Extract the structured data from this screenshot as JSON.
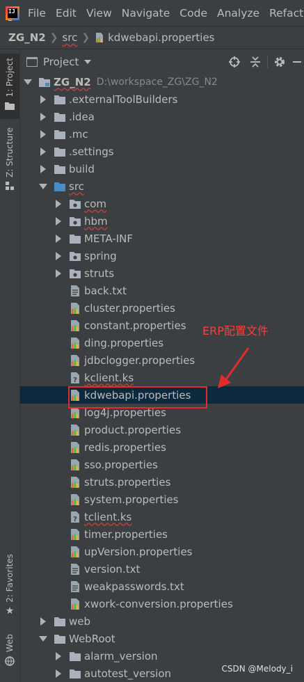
{
  "menu": [
    "File",
    "Edit",
    "View",
    "Navigate",
    "Code",
    "Analyze",
    "Refactor"
  ],
  "breadcrumb": [
    "ZG_N2",
    "src",
    "kdwebapi.properties"
  ],
  "left_tabs": [
    "1: Project",
    "Z: Structure",
    "2: Favorites",
    "Web"
  ],
  "panel": {
    "title": "Project"
  },
  "tree": [
    {
      "label": "ZG_N2",
      "depth": 0,
      "type": "module",
      "arrow": "down",
      "bold": true,
      "path": "D:\\workspace_ZG\\ZG_N2"
    },
    {
      "label": ".externalToolBuilders",
      "depth": 1,
      "type": "folder",
      "arrow": "right"
    },
    {
      "label": ".idea",
      "depth": 1,
      "type": "folder",
      "arrow": "right"
    },
    {
      "label": ".mc",
      "depth": 1,
      "type": "folder",
      "arrow": "right"
    },
    {
      "label": ".settings",
      "depth": 1,
      "type": "folder",
      "arrow": "right"
    },
    {
      "label": "build",
      "depth": 1,
      "type": "folder",
      "arrow": "right"
    },
    {
      "label": "src",
      "depth": 1,
      "type": "src-folder",
      "arrow": "down"
    },
    {
      "label": "com",
      "depth": 2,
      "type": "package",
      "arrow": "right"
    },
    {
      "label": "hbm",
      "depth": 2,
      "type": "package",
      "arrow": "right"
    },
    {
      "label": "META-INF",
      "depth": 2,
      "type": "folder",
      "arrow": "right"
    },
    {
      "label": "spring",
      "depth": 2,
      "type": "package",
      "arrow": "right"
    },
    {
      "label": "struts",
      "depth": 2,
      "type": "package",
      "arrow": "right"
    },
    {
      "label": "back.txt",
      "depth": 2,
      "type": "text"
    },
    {
      "label": "cluster.properties",
      "depth": 2,
      "type": "properties"
    },
    {
      "label": "constant.properties",
      "depth": 2,
      "type": "properties"
    },
    {
      "label": "ding.properties",
      "depth": 2,
      "type": "properties"
    },
    {
      "label": "jdbclogger.properties",
      "depth": 2,
      "type": "properties"
    },
    {
      "label": "kclient.ks",
      "depth": 2,
      "type": "unknown"
    },
    {
      "label": "kdwebapi.properties",
      "depth": 2,
      "type": "properties",
      "selected": true
    },
    {
      "label": "log4j.properties",
      "depth": 2,
      "type": "properties"
    },
    {
      "label": "product.properties",
      "depth": 2,
      "type": "properties"
    },
    {
      "label": "redis.properties",
      "depth": 2,
      "type": "properties"
    },
    {
      "label": "sso.properties",
      "depth": 2,
      "type": "properties"
    },
    {
      "label": "struts.properties",
      "depth": 2,
      "type": "properties"
    },
    {
      "label": "system.properties",
      "depth": 2,
      "type": "properties"
    },
    {
      "label": "tclient.ks",
      "depth": 2,
      "type": "unknown"
    },
    {
      "label": "timer.properties",
      "depth": 2,
      "type": "properties"
    },
    {
      "label": "upVersion.properties",
      "depth": 2,
      "type": "properties"
    },
    {
      "label": "version.txt",
      "depth": 2,
      "type": "text"
    },
    {
      "label": "weakpasswords.txt",
      "depth": 2,
      "type": "text"
    },
    {
      "label": "xwork-conversion.properties",
      "depth": 2,
      "type": "properties"
    },
    {
      "label": "web",
      "depth": 1,
      "type": "folder",
      "arrow": "right"
    },
    {
      "label": "WebRoot",
      "depth": 1,
      "type": "folder",
      "arrow": "down"
    },
    {
      "label": "alarm_version",
      "depth": 2,
      "type": "folder",
      "arrow": "right"
    },
    {
      "label": "autotest_version",
      "depth": 2,
      "type": "folder",
      "arrow": "right"
    }
  ],
  "annotation": {
    "text": "ERP配置文件"
  },
  "watermark": "CSDN @Melody_i",
  "colors": {
    "background": "#3c3f41",
    "selection": "#0d293e",
    "annotation": "#e02c2c",
    "folder": "#a9b2bc",
    "src_folder": "#4a8bc2"
  }
}
